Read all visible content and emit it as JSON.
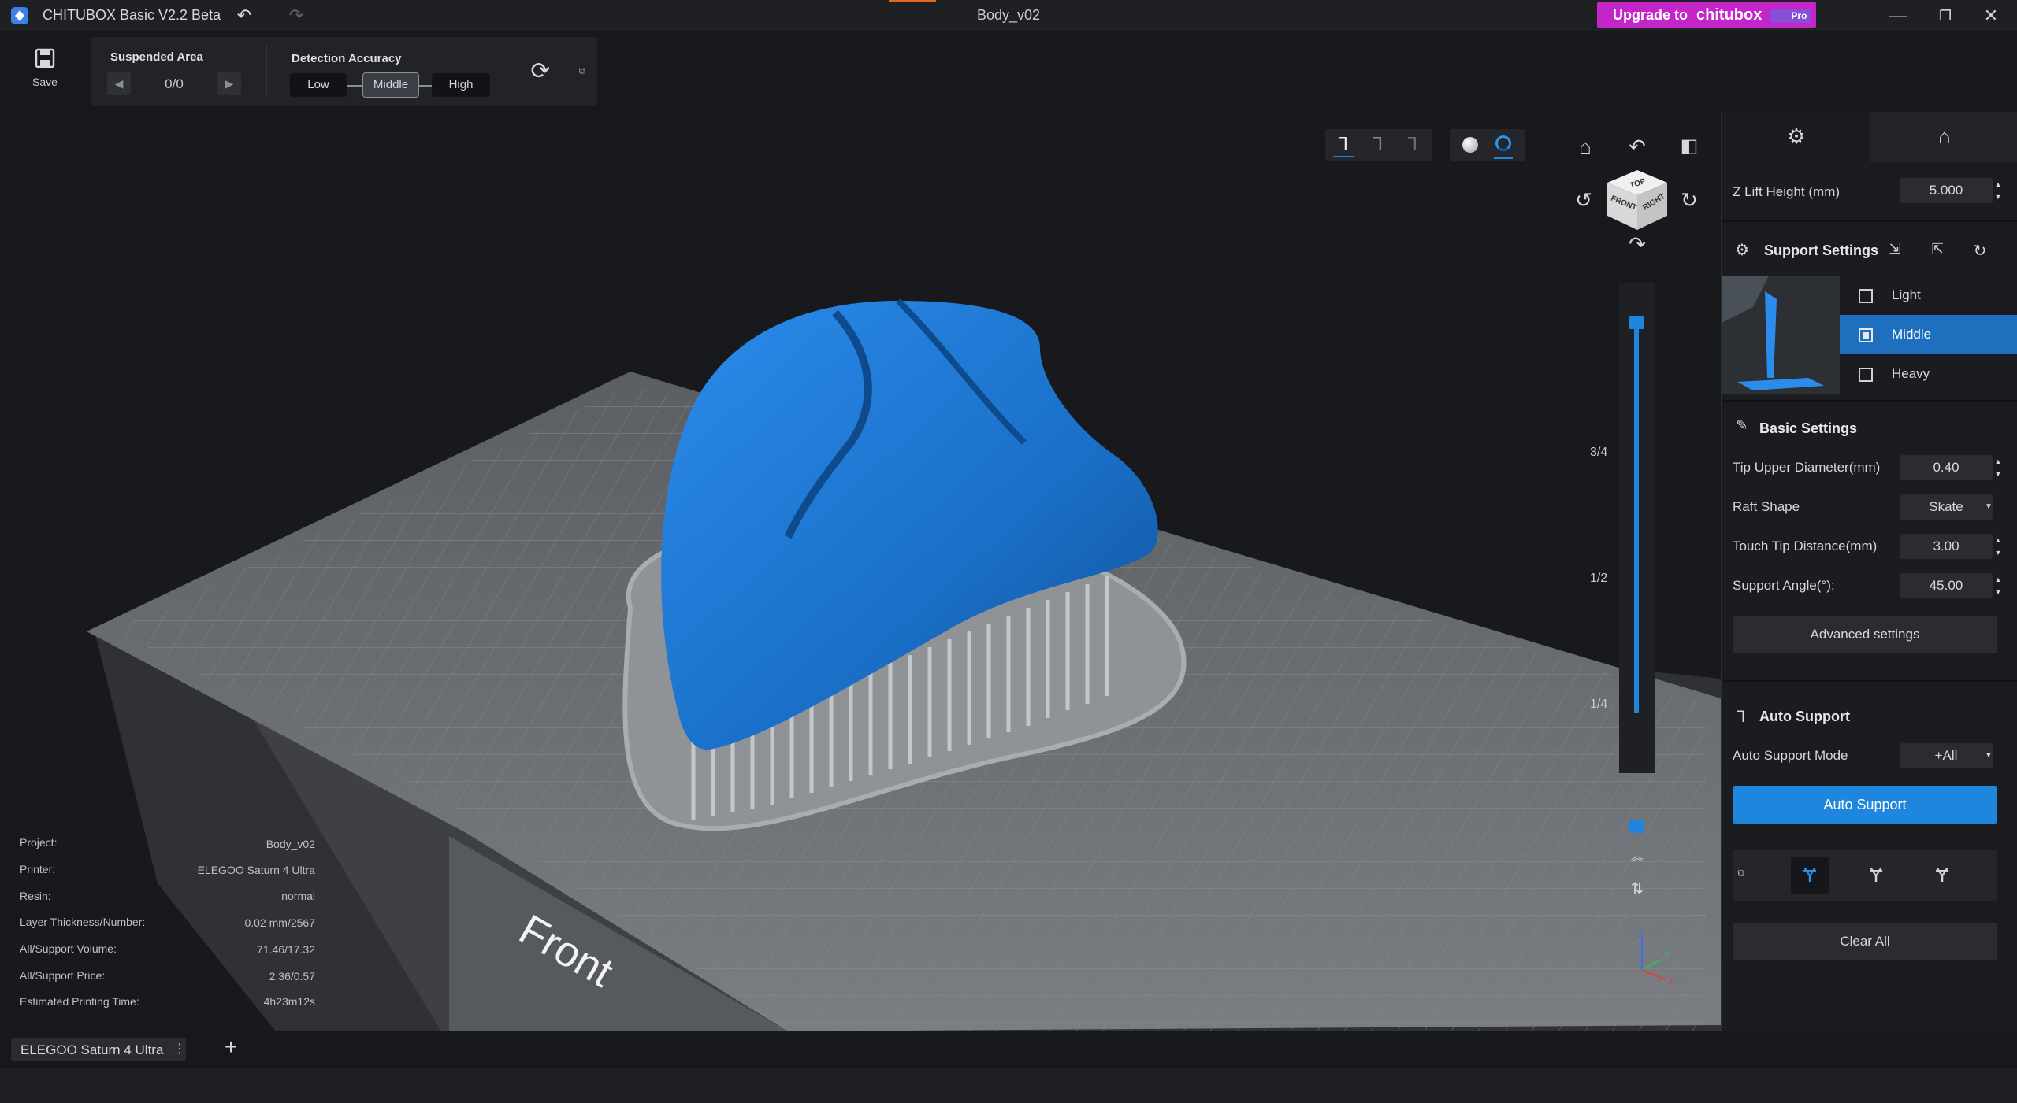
{
  "titlebar": {
    "app_title": "CHITUBOX Basic V2.2 Beta",
    "doc_title": "Body_v02",
    "upgrade_label": "Upgrade to",
    "upgrade_brand": "chitubox",
    "upgrade_pro": "Pro"
  },
  "toolbar": {
    "save_label": "Save",
    "suspended_area_label": "Suspended Area",
    "suspended_area_value": "0/0",
    "detection_accuracy_label": "Detection Accuracy",
    "accuracy_options": [
      "Low",
      "Middle",
      "High"
    ],
    "accuracy_selected": "Middle"
  },
  "viewport": {
    "plate_label": "Front",
    "view_cube": {
      "top": "TOP",
      "front": "FRONT",
      "right": "RIGHT"
    },
    "slider_marks": [
      "3/4",
      "1/2",
      "1/4"
    ],
    "axis": {
      "x": "X",
      "y": "Y",
      "z": "Z"
    }
  },
  "info": [
    {
      "key": "Project:",
      "value": "Body_v02"
    },
    {
      "key": "Printer:",
      "value": "ELEGOO Saturn 4 Ultra"
    },
    {
      "key": "Resin:",
      "value": "normal"
    },
    {
      "key": "Layer Thickness/Number:",
      "value": "0.02 mm/2567"
    },
    {
      "key": "All/Support Volume:",
      "value": "71.46/17.32"
    },
    {
      "key": "All/Support Price:",
      "value": "2.36/0.57"
    },
    {
      "key": "Estimated Printing Time:",
      "value": "4h23m12s"
    }
  ],
  "right_panel": {
    "z_lift_label": "Z Lift Height (mm)",
    "z_lift_value": "5.000",
    "support_settings_title": "Support Settings",
    "presets": [
      "Light",
      "Middle",
      "Heavy"
    ],
    "preset_selected": "Middle",
    "basic_settings_title": "Basic Settings",
    "tip_upper_label": "Tip Upper Diameter(mm)",
    "tip_upper_value": "0.40",
    "raft_shape_label": "Raft Shape",
    "raft_shape_value": "Skate",
    "touch_tip_label": "Touch Tip Distance(mm)",
    "touch_tip_value": "3.00",
    "support_angle_label": "Support Angle(°):",
    "support_angle_value": "45.00",
    "advanced_label": "Advanced settings",
    "auto_support_title": "Auto Support",
    "auto_mode_label": "Auto Support Mode",
    "auto_mode_value": "+All",
    "auto_support_button": "Auto Support",
    "clear_all_button": "Clear All"
  },
  "bottom": {
    "printer_tab": "ELEGOO Saturn 4 Ultra"
  },
  "colors": {
    "accent": "#1f86de",
    "model": "#1f7ad6",
    "upgrade": "#c425c9"
  }
}
